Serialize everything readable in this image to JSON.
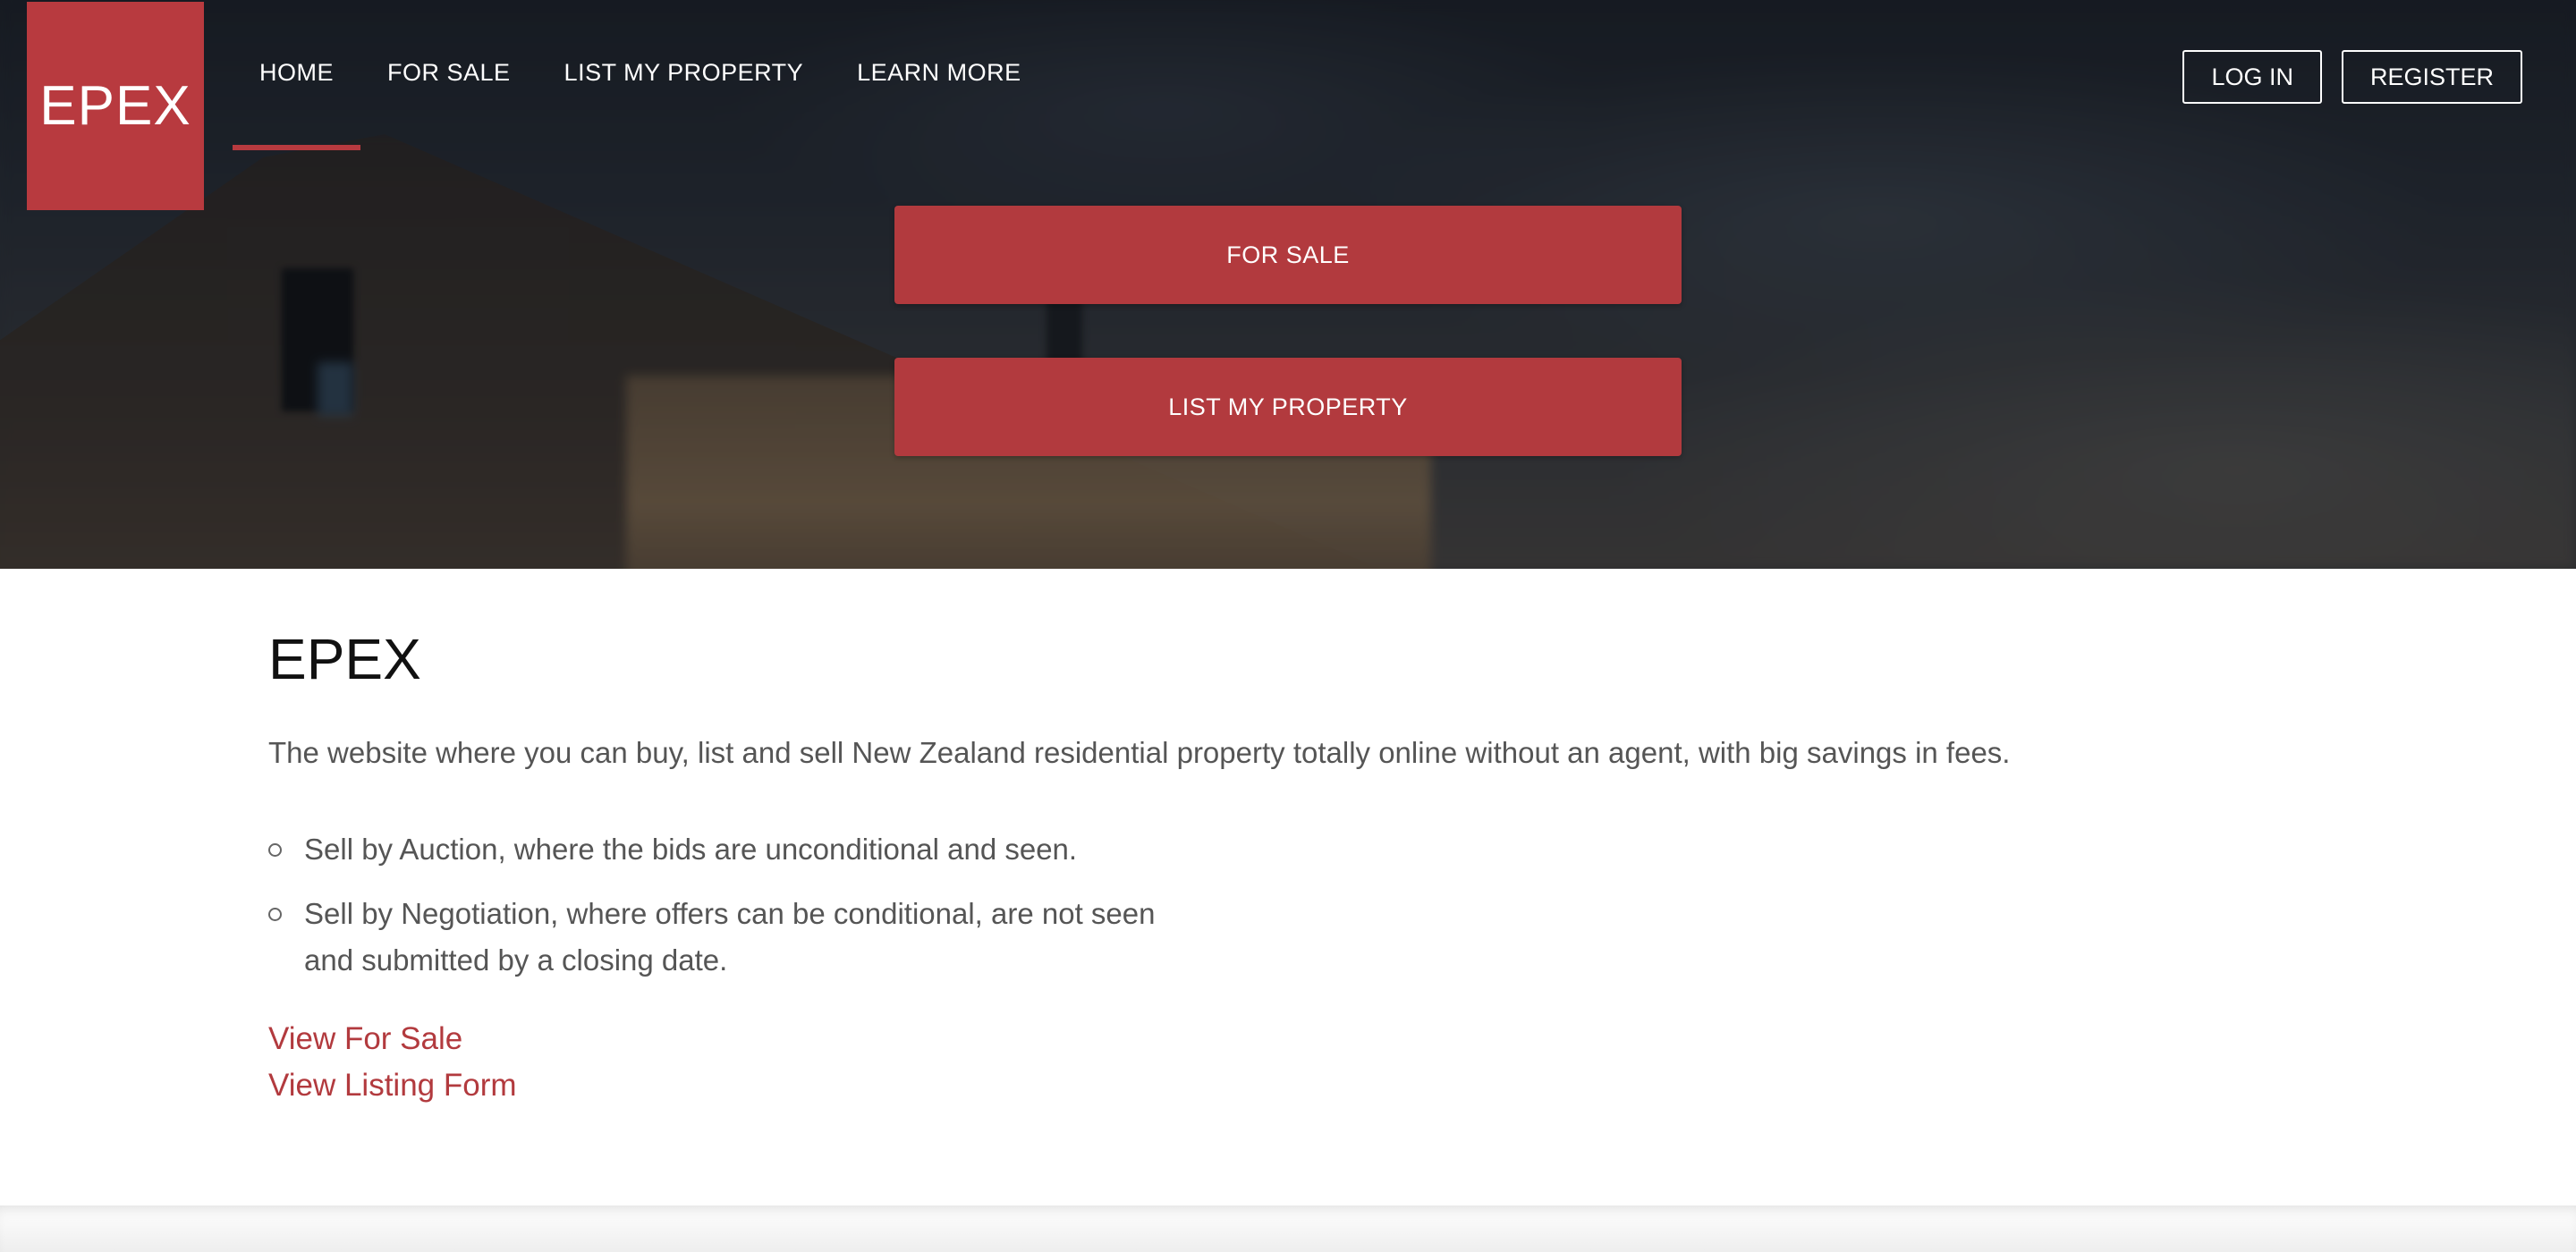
{
  "brand": {
    "logo_text": "EPEX"
  },
  "nav": {
    "items": [
      {
        "label": "HOME",
        "active": true
      },
      {
        "label": "FOR SALE",
        "active": false
      },
      {
        "label": "LIST MY PROPERTY",
        "active": false
      },
      {
        "label": "LEARN MORE",
        "active": false
      }
    ]
  },
  "auth": {
    "login_label": "LOG IN",
    "register_label": "REGISTER"
  },
  "hero": {
    "cta_for_sale": "FOR SALE",
    "cta_list_property": "LIST MY PROPERTY"
  },
  "main": {
    "title": "EPEX",
    "intro": "The website where you can buy, list and sell New Zealand residential property totally online without an agent, with big savings in fees.",
    "bullets": [
      "Sell by Auction, where the bids are unconditional and seen.",
      "Sell by Negotiation, where offers can be conditional, are not seen and submitted by a closing date."
    ],
    "links": {
      "view_for_sale": "View For Sale",
      "view_listing_form": "View Listing Form"
    }
  },
  "colors": {
    "accent": "#b83a3f",
    "link": "#b23a3e",
    "body_text": "#555555",
    "heading_text": "#111111"
  }
}
